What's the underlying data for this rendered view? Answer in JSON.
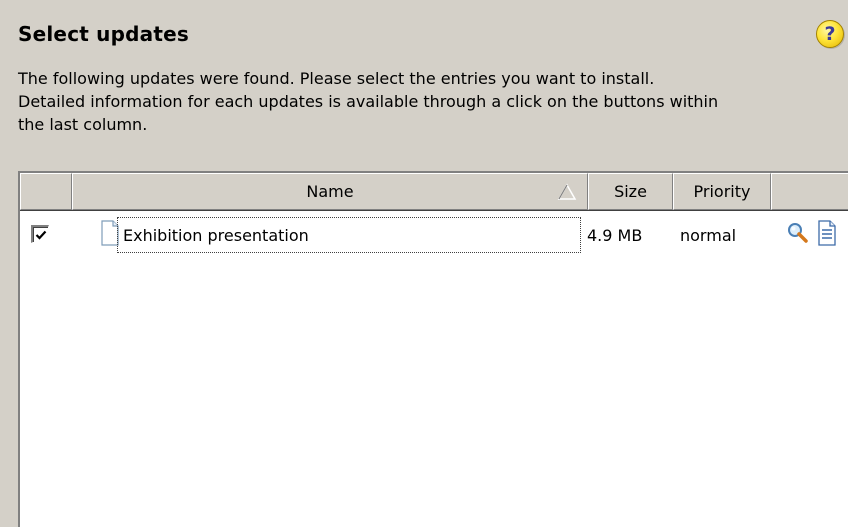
{
  "header": {
    "title": "Select updates",
    "help_icon": "help-icon",
    "help_glyph": "?"
  },
  "description": "The following updates were found. Please select the entries you want to install.\nDetailed information for each updates is available through a click on the buttons within\nthe last column.",
  "table": {
    "columns": {
      "check": "",
      "name": "Name",
      "size": "Size",
      "priority": "Priority",
      "actions": ""
    },
    "sort": {
      "column": "Name",
      "direction": "ascending"
    },
    "rows": [
      {
        "checked": true,
        "icon": "document-icon",
        "name": "Exhibition presentation",
        "size": "4.9 MB",
        "priority": "normal",
        "actions": [
          "search-icon",
          "details-document-icon"
        ]
      }
    ]
  }
}
